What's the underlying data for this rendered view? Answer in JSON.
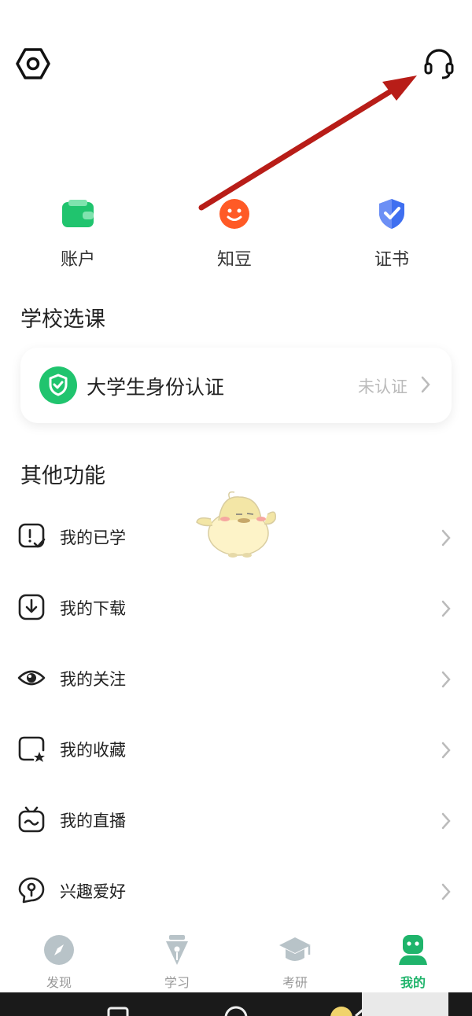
{
  "header": {
    "settings_icon": "hexagon-settings-icon",
    "service_icon": "headset-icon",
    "annotation_color": "#c0201a"
  },
  "quick_actions": [
    {
      "label": "账户",
      "icon": "wallet-icon",
      "color": "#20c46e"
    },
    {
      "label": "知豆",
      "icon": "smiley-coin-icon",
      "color": "#ff5a26"
    },
    {
      "label": "证书",
      "icon": "shield-check-icon",
      "color": "#3f6ff0"
    }
  ],
  "school": {
    "title": "学校选课",
    "verify_label": "大学生身份认证",
    "verify_status": "未认证",
    "verify_icon_color": "#20c46e"
  },
  "other": {
    "title": "其他功能",
    "items": [
      {
        "label": "我的已学",
        "icon": "learned-icon"
      },
      {
        "label": "我的下载",
        "icon": "download-icon"
      },
      {
        "label": "我的关注",
        "icon": "eye-icon"
      },
      {
        "label": "我的收藏",
        "icon": "star-folder-icon"
      },
      {
        "label": "我的直播",
        "icon": "tv-icon"
      },
      {
        "label": "兴趣爱好",
        "icon": "interest-icon"
      }
    ]
  },
  "tabs": [
    {
      "label": "发现",
      "icon": "compass-icon"
    },
    {
      "label": "学习",
      "icon": "pen-icon"
    },
    {
      "label": "考研",
      "icon": "graduation-cap-icon"
    },
    {
      "label": "我的",
      "icon": "profile-icon",
      "active": true
    }
  ],
  "accent_color": "#1fb46b"
}
